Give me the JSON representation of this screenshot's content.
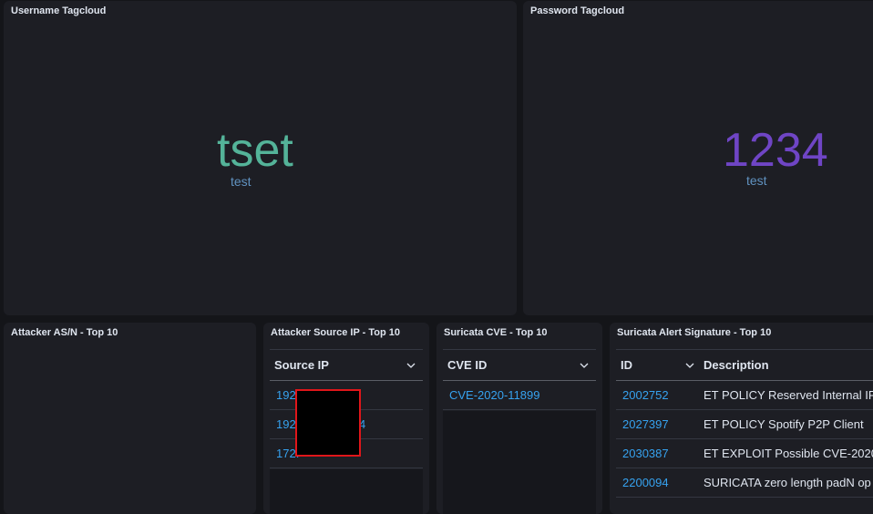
{
  "username_panel": {
    "title": "Username Tagcloud",
    "tags": [
      {
        "text": "tset",
        "color": "#54b399"
      },
      {
        "text": "test",
        "color": "#6092c0"
      }
    ]
  },
  "password_panel": {
    "title": "Password Tagcloud",
    "tags": [
      {
        "text": "1234",
        "color": "#6f45c5"
      },
      {
        "text": "test",
        "color": "#6092c0"
      }
    ]
  },
  "asn_panel": {
    "title": "Attacker AS/N - Top 10"
  },
  "source_ip_panel": {
    "title": "Attacker Source IP - Top 10",
    "column": "Source IP",
    "rows": [
      {
        "ip": "192"
      },
      {
        "ip": "192",
        "suffix": "4"
      },
      {
        "ip": "172."
      }
    ]
  },
  "cve_panel": {
    "title": "Suricata CVE - Top 10",
    "column": "CVE ID",
    "rows": [
      {
        "cve": "CVE-2020-11899"
      }
    ]
  },
  "signature_panel": {
    "title": "Suricata Alert Signature - Top 10",
    "columns": [
      "ID",
      "Description"
    ],
    "rows": [
      {
        "id": "2002752",
        "description": "ET POLICY Reserved Internal IP"
      },
      {
        "id": "2027397",
        "description": "ET POLICY Spotify P2P Client"
      },
      {
        "id": "2030387",
        "description": "ET EXPLOIT Possible CVE-2020"
      },
      {
        "id": "2200094",
        "description": "SURICATA zero length padN op"
      }
    ]
  },
  "icons": {
    "sort": "chevron-down-icon"
  }
}
